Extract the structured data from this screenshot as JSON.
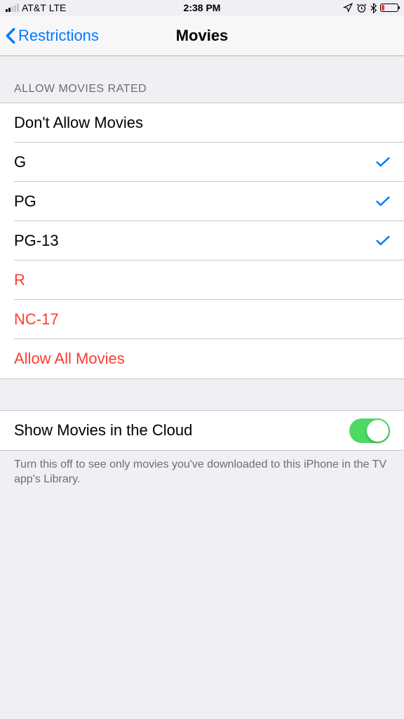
{
  "status_bar": {
    "carrier": "AT&T",
    "network": "LTE",
    "time": "2:38 PM"
  },
  "nav": {
    "back_label": "Restrictions",
    "title": "Movies"
  },
  "sections": {
    "ratings": {
      "header": "ALLOW MOVIES RATED",
      "items": [
        {
          "label": "Don't Allow Movies",
          "checked": false,
          "red": false
        },
        {
          "label": "G",
          "checked": true,
          "red": false
        },
        {
          "label": "PG",
          "checked": true,
          "red": false
        },
        {
          "label": "PG-13",
          "checked": true,
          "red": false
        },
        {
          "label": "R",
          "checked": false,
          "red": true
        },
        {
          "label": "NC-17",
          "checked": false,
          "red": true
        },
        {
          "label": "Allow All Movies",
          "checked": false,
          "red": true
        }
      ]
    },
    "cloud": {
      "item_label": "Show Movies in the Cloud",
      "switch_on": true,
      "footer": "Turn this off to see only movies you've downloaded to this iPhone in the TV app's Library."
    }
  }
}
